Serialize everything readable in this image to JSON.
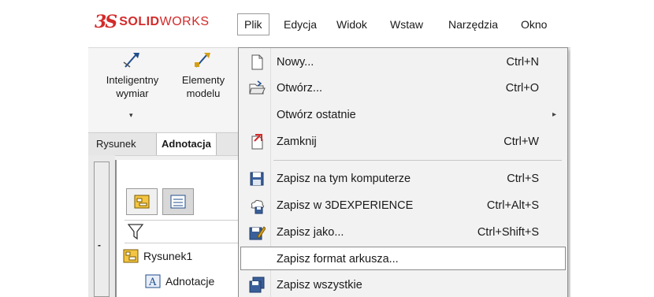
{
  "logo": {
    "ds": "3S",
    "solid": "SOLID",
    "works": "WORKS"
  },
  "menubar": {
    "items": [
      "Plik",
      "Edycja",
      "Widok",
      "Wstaw",
      "Narzędzia",
      "Okno"
    ],
    "active": "Plik"
  },
  "command_manager": {
    "buttons": [
      {
        "label_line1": "Inteligentny",
        "label_line2": "wymiar",
        "icon": "smart-dimension-icon"
      },
      {
        "label_line1": "Elementy",
        "label_line2": "modelu",
        "icon": "model-items-icon"
      }
    ],
    "caret": "▾"
  },
  "tabs": [
    "Rysunek",
    "Adnotacja"
  ],
  "tab_selected": "Adnotacja",
  "tree": {
    "dock_label": "-",
    "nodes": [
      "Rysunek1",
      "Adnotacje"
    ]
  },
  "file_menu": {
    "items": [
      {
        "label": "Nowy...",
        "shortcut": "Ctrl+N",
        "icon": "new-document-icon"
      },
      {
        "label": "Otwórz...",
        "shortcut": "Ctrl+O",
        "icon": "open-folder-icon"
      },
      {
        "label": "Otwórz ostatnie",
        "shortcut": "",
        "icon": "",
        "submenu": "▸"
      },
      {
        "label": "Zamknij",
        "shortcut": "Ctrl+W",
        "icon": "close-document-icon"
      },
      {
        "label": "Zapisz na tym komputerze",
        "shortcut": "Ctrl+S",
        "icon": "save-disk-icon"
      },
      {
        "label": "Zapisz w 3DEXPERIENCE",
        "shortcut": "Ctrl+Alt+S",
        "icon": "save-cloud-icon"
      },
      {
        "label": "Zapisz jako...",
        "shortcut": "Ctrl+Shift+S",
        "icon": "save-as-icon"
      },
      {
        "label": "Zapisz format arkusza...",
        "shortcut": "",
        "icon": ""
      },
      {
        "label": "Zapisz wszystkie",
        "shortcut": "",
        "icon": "save-all-icon"
      }
    ],
    "hovered_item": "Zapisz format arkusza..."
  },
  "colors": {
    "brand": "#d42a2a",
    "menu_bg": "#f2f2f2",
    "hover_bg": "#ffffff"
  }
}
